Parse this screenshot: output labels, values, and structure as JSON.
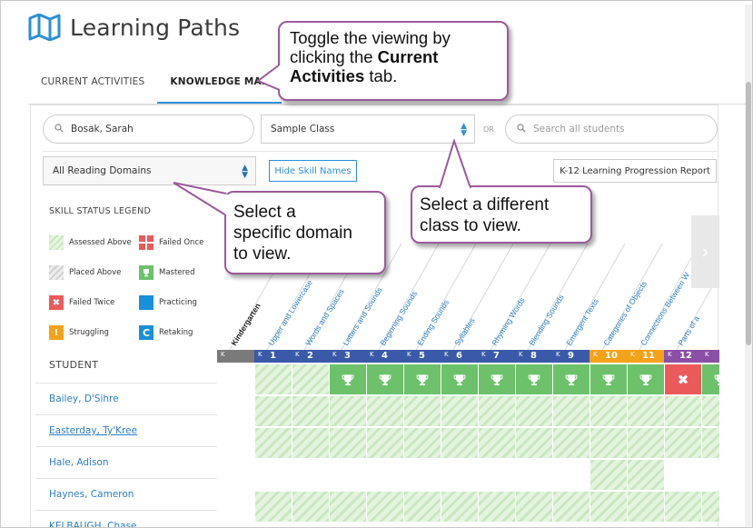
{
  "app": {
    "title": "Learning Paths",
    "logo_icon": "map-icon"
  },
  "tabs": [
    {
      "label": "CURRENT ACTIVITIES",
      "active": false
    },
    {
      "label": "KNOWLEDGE MAP",
      "active": true
    }
  ],
  "filters": {
    "student_search_value": "Bosak, Sarah",
    "class_select_value": "Sample Class",
    "or_label": "OR",
    "all_students_placeholder": "Search all students",
    "domain_select_value": "All Reading Domains",
    "hide_skill_names_label": "Hide Skill Names",
    "report_button_label": "K-12 Learning Progression Report"
  },
  "legend": {
    "title": "SKILL STATUS LEGEND",
    "items": [
      {
        "label": "Assessed Above"
      },
      {
        "label": "Failed Once"
      },
      {
        "label": "Placed Above"
      },
      {
        "label": "Mastered"
      },
      {
        "label": "Failed Twice"
      },
      {
        "label": "Practicing"
      },
      {
        "label": "Struggling"
      },
      {
        "label": "Retaking"
      }
    ]
  },
  "students": {
    "header": "STUDENT",
    "rows": [
      {
        "name": "Bailey, D'Sihre"
      },
      {
        "name": "Easterday, Ty'Kree"
      },
      {
        "name": "Hale, Adison"
      },
      {
        "name": "Haynes, Cameron"
      },
      {
        "name": "KELBAUGH, Chase"
      }
    ]
  },
  "skills": [
    "Kindergarten",
    "Upper and Lowercase",
    "Words and Spaces",
    "Letters and Sounds",
    "Beginning Sounds",
    "Ending Sounds",
    "Syllables",
    "Rhyming Words",
    "Blending Sounds",
    "Emergent Texts",
    "Categories of Objects",
    "Connections Between W",
    "Parts of a"
  ],
  "domain_bar": [
    {
      "k": "K",
      "num": "",
      "color": "#7a7a7a"
    },
    {
      "k": "K",
      "num": "1",
      "color": "#3a59a8"
    },
    {
      "k": "K",
      "num": "2",
      "color": "#3a59a8"
    },
    {
      "k": "K",
      "num": "3",
      "color": "#3a59a8"
    },
    {
      "k": "K",
      "num": "4",
      "color": "#3a59a8"
    },
    {
      "k": "K",
      "num": "5",
      "color": "#3a59a8"
    },
    {
      "k": "K",
      "num": "6",
      "color": "#3a59a8"
    },
    {
      "k": "K",
      "num": "7",
      "color": "#3a59a8"
    },
    {
      "k": "K",
      "num": "8",
      "color": "#3a59a8"
    },
    {
      "k": "K",
      "num": "9",
      "color": "#3a59a8"
    },
    {
      "k": "K",
      "num": "10",
      "color": "#f4a21b"
    },
    {
      "k": "K",
      "num": "11",
      "color": "#f4a21b"
    },
    {
      "k": "K",
      "num": "12",
      "color": "#8b4fa8"
    },
    {
      "k": "K",
      "num": "",
      "color": "#8b4fa8"
    }
  ],
  "grid": [
    [
      "white",
      "gh",
      "gh",
      "mastered",
      "mastered",
      "mastered",
      "mastered",
      "mastered",
      "mastered",
      "mastered",
      "mastered",
      "mastered",
      "failed",
      "mastered"
    ],
    [
      "white",
      "gh",
      "gh",
      "gh",
      "gh",
      "gh",
      "gh",
      "gh",
      "gh",
      "gh",
      "gh",
      "gh",
      "gh",
      "gh"
    ],
    [
      "white",
      "gh",
      "gh",
      "gh",
      "gh",
      "gh",
      "gh",
      "gh",
      "gh",
      "gh",
      "gh",
      "gh",
      "gh",
      "gh"
    ],
    [
      "white",
      "white",
      "white",
      "white",
      "white",
      "white",
      "white",
      "white",
      "white",
      "white",
      "gh",
      "gh",
      "white",
      "white"
    ],
    [
      "white",
      "gh",
      "gh",
      "gh",
      "gh",
      "gh",
      "gh",
      "gh",
      "gh",
      "gh",
      "gh",
      "gh",
      "gh",
      "gh"
    ]
  ],
  "callouts": {
    "tab_hint": {
      "line1": "Toggle the viewing by",
      "line2": "clicking the",
      "bold1": "Current",
      "bold2": "Activities",
      "line3": "tab."
    },
    "domain_hint": {
      "line1": "Select a",
      "line2": "specific domain",
      "line3": "to view."
    },
    "class_hint": {
      "line1": "Select a different",
      "line2": "class to view."
    }
  },
  "colors": {
    "accent": "#2b8fd6",
    "mastered": "#6cc16a",
    "failed": "#eb5a5a",
    "callout_border": "#9a5a9a"
  }
}
